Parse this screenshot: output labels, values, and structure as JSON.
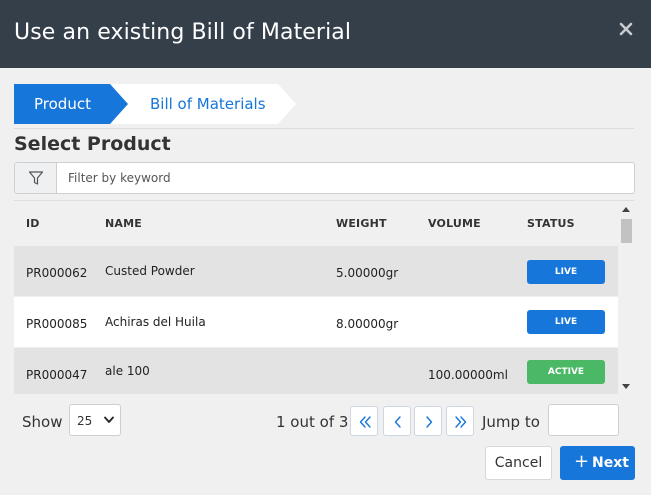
{
  "modal": {
    "title": "Use an existing Bill of Material",
    "close_icon": "close-icon"
  },
  "wizard": {
    "steps": [
      {
        "label": "Product",
        "active": true
      },
      {
        "label": "Bill of Materials",
        "active": false
      }
    ]
  },
  "section": {
    "title": "Select Product"
  },
  "filter": {
    "placeholder": "Filter by keyword",
    "value": "",
    "icon": "filter-icon"
  },
  "table": {
    "columns": [
      "ID",
      "NAME",
      "WEIGHT",
      "VOLUME",
      "STATUS"
    ],
    "rows": [
      {
        "id": "PR000062",
        "name": "Custed Powder",
        "weight": "5.00000gr",
        "volume": "",
        "status": "LIVE"
      },
      {
        "id": "PR000085",
        "name": "Achiras del Huila",
        "weight": "8.00000gr",
        "volume": "",
        "status": "LIVE"
      },
      {
        "id": "PR000047",
        "name": "ale 100",
        "weight": "",
        "volume": "100.00000ml",
        "status": "ACTIVE"
      }
    ]
  },
  "pagination": {
    "show_label": "Show",
    "page_size": "25",
    "page_info": "1 out of 3",
    "jump_label": "Jump to",
    "jump_value": ""
  },
  "footer": {
    "cancel_label": "Cancel",
    "next_label": "Next"
  },
  "colors": {
    "header_bg": "#343f4a",
    "primary": "#1676d9",
    "live": "#1676d9",
    "active": "#4bb866"
  }
}
